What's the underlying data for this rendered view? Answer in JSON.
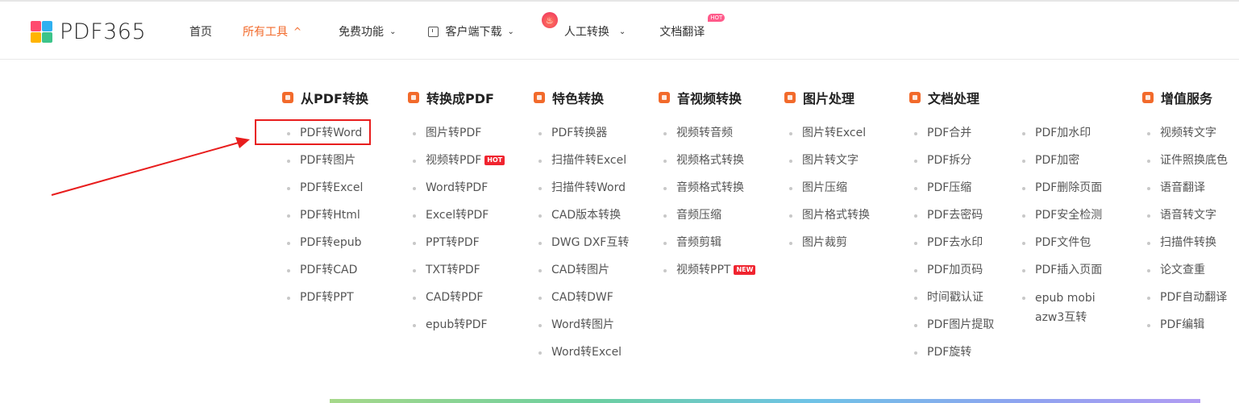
{
  "header": {
    "logo_text": "PDF365",
    "logo_colors": [
      "#ff4b6e",
      "#2fb0f0",
      "#ffb400",
      "#3cc48a"
    ],
    "nav": [
      {
        "label": "首页"
      },
      {
        "label": "所有工具",
        "chevron": "^"
      },
      {
        "label": "免费功能",
        "chevron": "⌄"
      },
      {
        "label": "客户端下载",
        "chevron": "⌄"
      },
      {
        "label": "人工转换",
        "chevron": "⌄"
      },
      {
        "label": "文档翻译",
        "tag": "HOT"
      }
    ]
  },
  "colors": {
    "accent": "#f26a2b",
    "badge_red": "#f0242f",
    "highlight": "#e81d1d"
  },
  "menu": {
    "from_pdf": {
      "title": "从PDF转换",
      "items": [
        "PDF转Word",
        "PDF转图片",
        "PDF转Excel",
        "PDF转Html",
        "PDF转epub",
        "PDF转CAD",
        "PDF转PPT"
      ]
    },
    "to_pdf": {
      "title": "转换成PDF",
      "items": [
        "图片转PDF",
        "视频转PDF",
        "Word转PDF",
        "Excel转PDF",
        "PPT转PDF",
        "TXT转PDF",
        "CAD转PDF",
        "epub转PDF"
      ],
      "badge": "HOT"
    },
    "special": {
      "title": "特色转换",
      "items": [
        "PDF转换器",
        "扫描件转Excel",
        "扫描件转Word",
        "CAD版本转换",
        "DWG DXF互转",
        "CAD转图片",
        "CAD转DWF",
        "Word转图片",
        "Word转Excel"
      ]
    },
    "av": {
      "title": "音视频转换",
      "items": [
        "视频转音频",
        "视频格式转换",
        "音频格式转换",
        "音频压缩",
        "音频剪辑",
        "视频转PPT"
      ],
      "badge": "NEW"
    },
    "image": {
      "title": "图片处理",
      "items": [
        "图片转Excel",
        "图片转文字",
        "图片压缩",
        "图片格式转换",
        "图片裁剪"
      ]
    },
    "doc": {
      "title": "文档处理",
      "items_a": [
        "PDF合并",
        "PDF拆分",
        "PDF压缩",
        "PDF去密码",
        "PDF去水印",
        "PDF加页码",
        "时间戳认证",
        "PDF图片提取",
        "PDF旋转"
      ],
      "items_b": [
        "PDF加水印",
        "PDF加密",
        "PDF删除页面",
        "PDF安全检测",
        "PDF文件包",
        "PDF插入页面",
        "epub mobi azw3互转"
      ]
    },
    "value": {
      "title": "增值服务",
      "items": [
        "视频转文字",
        "证件照换底色",
        "语音翻译",
        "语音转文字",
        "扫描件转换",
        "论文查重",
        "PDF自动翻译",
        "PDF编辑"
      ]
    }
  }
}
